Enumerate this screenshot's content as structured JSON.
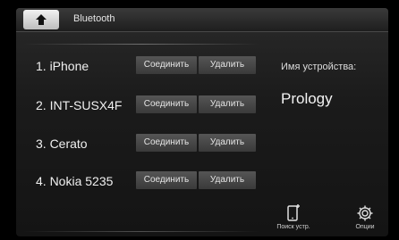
{
  "header": {
    "title": "Bluetooth",
    "home_icon": "home-icon"
  },
  "devices": [
    {
      "name": "1. iPhone",
      "connect_label": "Соединить",
      "delete_label": "Удалить"
    },
    {
      "name": "2. INT-SUSX4F",
      "connect_label": "Соединить",
      "delete_label": "Удалить"
    },
    {
      "name": "3. Cerato",
      "connect_label": "Соединить",
      "delete_label": "Удалить"
    },
    {
      "name": "4. Nokia 5235",
      "connect_label": "Соединить",
      "delete_label": "Удалить"
    }
  ],
  "side_panel": {
    "device_name_label": "Имя устройства:",
    "device_name_value": "Prology"
  },
  "bottom_bar": {
    "search_label": "Поиск устр.",
    "search_icon": "phone-search-icon",
    "options_label": "Опции",
    "options_icon": "gear-icon"
  },
  "colors": {
    "background": "#000000",
    "text": "#f0f0f0",
    "button_bg": "#4a4a4a"
  }
}
